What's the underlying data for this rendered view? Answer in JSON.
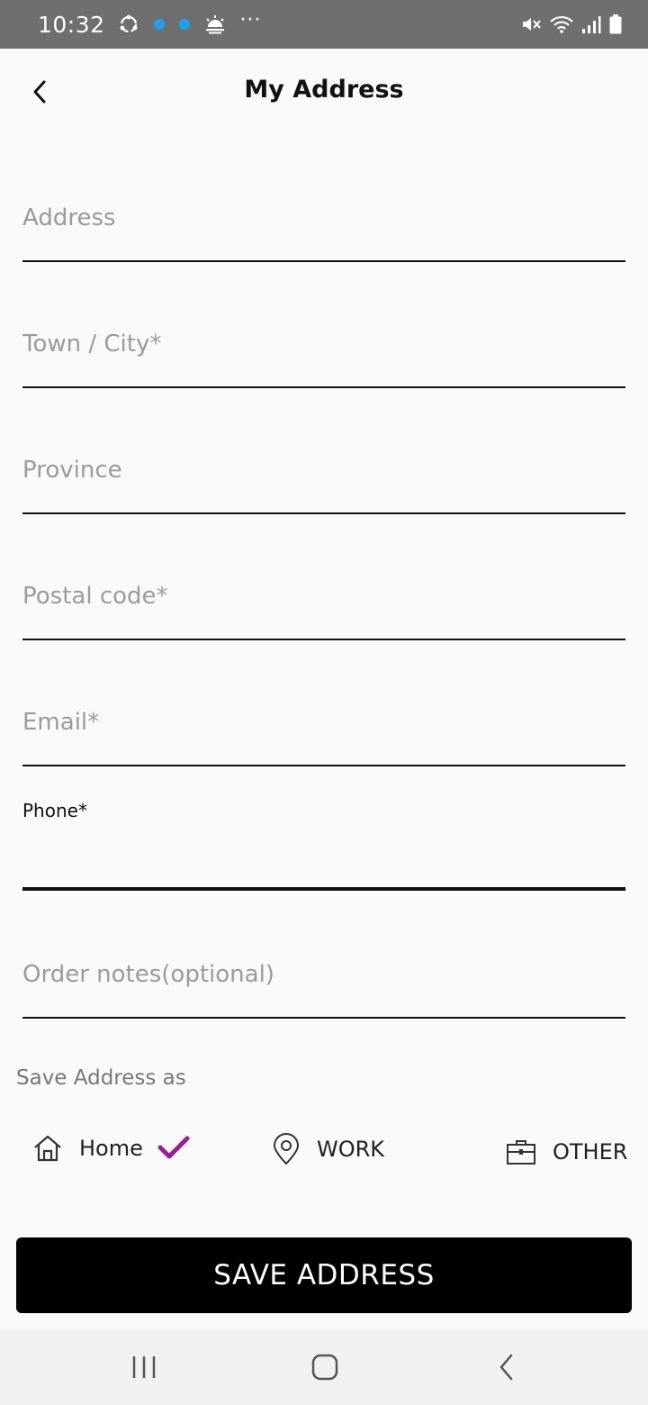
{
  "status_bar": {
    "time": "10:32",
    "left_icons": [
      "sync-icon",
      "notification-dot-icon",
      "notification-dot-icon",
      "weather-icon",
      "more-notifications-icon"
    ],
    "right_icons": [
      "mute-icon",
      "wifi-icon",
      "signal-icon",
      "battery-icon"
    ],
    "more": "···"
  },
  "header": {
    "title": "My Address",
    "back_icon": "chevron-left-icon"
  },
  "form": {
    "address_placeholder": "Address",
    "town_placeholder": "Town / City*",
    "province_placeholder": "Province",
    "postal_placeholder": "Postal code*",
    "email_placeholder": "Email*",
    "phone_label": "Phone*",
    "phone_value": "",
    "notes_placeholder": "Order notes(optional)"
  },
  "save_as": {
    "label": "Save Address as",
    "options": [
      {
        "label": "Home",
        "icon": "home-icon",
        "selected": true
      },
      {
        "label": "WORK",
        "icon": "location-pin-icon",
        "selected": false
      },
      {
        "label": "OTHER",
        "icon": "briefcase-icon",
        "selected": false
      }
    ],
    "selected_color": "#9c1c9c"
  },
  "save_button": {
    "label": "SAVE ADDRESS"
  },
  "nav_bar": {
    "icons": [
      "recent-apps-icon",
      "home-nav-icon",
      "back-nav-icon"
    ]
  }
}
